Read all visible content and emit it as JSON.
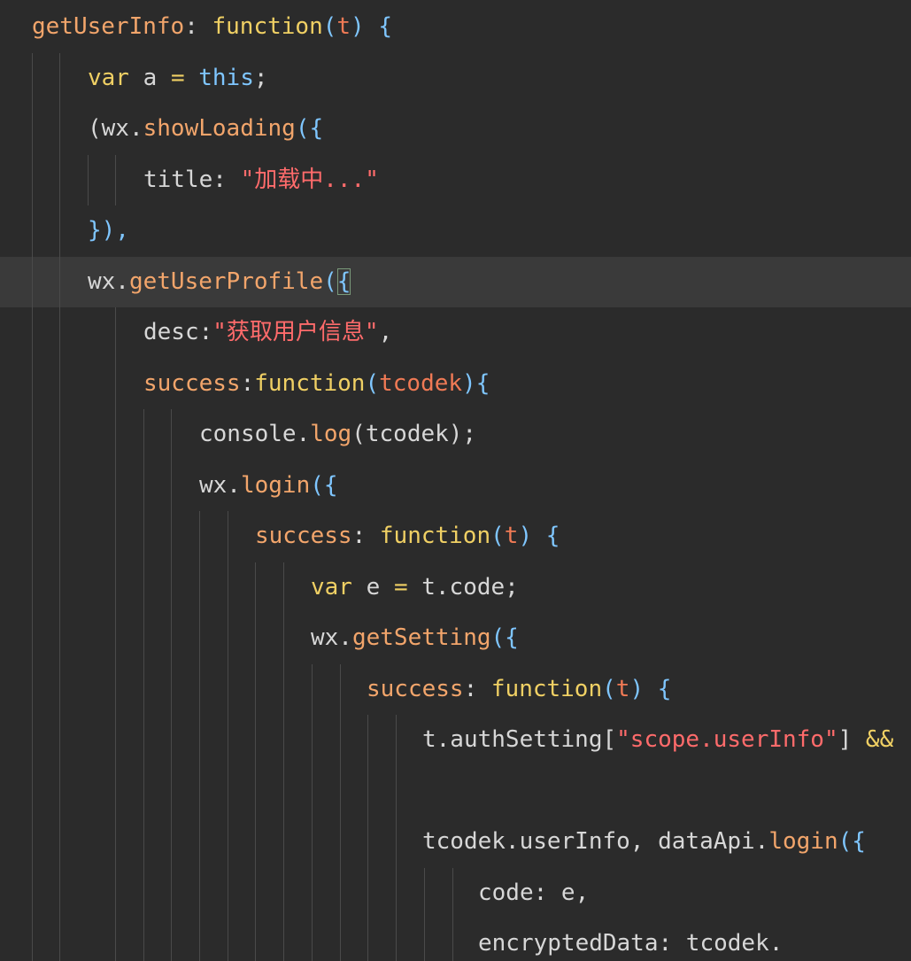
{
  "editor": {
    "lines": [
      {
        "indent": 0,
        "tokens": [
          {
            "t": "getUserInfo",
            "c": "key"
          },
          {
            "t": ": ",
            "c": "plain"
          },
          {
            "t": "function",
            "c": "fn"
          },
          {
            "t": "(",
            "c": "brace"
          },
          {
            "t": "t",
            "c": "param"
          },
          {
            "t": ") ",
            "c": "brace"
          },
          {
            "t": "{",
            "c": "brace"
          }
        ]
      },
      {
        "indent": 1,
        "tokens": [
          {
            "t": "var",
            "c": "kw"
          },
          {
            "t": " a ",
            "c": "plain"
          },
          {
            "t": "=",
            "c": "op"
          },
          {
            "t": " ",
            "c": "plain"
          },
          {
            "t": "this",
            "c": "this"
          },
          {
            "t": ";",
            "c": "plain"
          }
        ]
      },
      {
        "indent": 1,
        "tokens": [
          {
            "t": "(wx.",
            "c": "plain"
          },
          {
            "t": "showLoading",
            "c": "method"
          },
          {
            "t": "({",
            "c": "brace"
          }
        ]
      },
      {
        "indent": 2,
        "tokens": [
          {
            "t": "title: ",
            "c": "plain"
          },
          {
            "t": "\"加载中...\"",
            "c": "str"
          }
        ]
      },
      {
        "indent": 1,
        "tokens": [
          {
            "t": "}),",
            "c": "brace"
          }
        ]
      },
      {
        "indent": 1,
        "highlight": true,
        "tokens": [
          {
            "t": "wx.",
            "c": "plain"
          },
          {
            "t": "getUserProfile",
            "c": "method"
          },
          {
            "t": "(",
            "c": "brace"
          },
          {
            "t": "{",
            "c": "brace",
            "match": true
          }
        ]
      },
      {
        "indent": 2,
        "tokens": [
          {
            "t": "desc:",
            "c": "plain"
          },
          {
            "t": "\"获取用户信息\"",
            "c": "str"
          },
          {
            "t": ",",
            "c": "plain"
          }
        ]
      },
      {
        "indent": 2,
        "tokens": [
          {
            "t": "success",
            "c": "key"
          },
          {
            "t": ":",
            "c": "plain"
          },
          {
            "t": "function",
            "c": "fn"
          },
          {
            "t": "(",
            "c": "brace"
          },
          {
            "t": "tcodek",
            "c": "param"
          },
          {
            "t": "){",
            "c": "brace"
          }
        ]
      },
      {
        "indent": 3,
        "tokens": [
          {
            "t": "console.",
            "c": "plain"
          },
          {
            "t": "log",
            "c": "method"
          },
          {
            "t": "(tcodek);",
            "c": "plain"
          }
        ]
      },
      {
        "indent": 3,
        "tokens": [
          {
            "t": "wx.",
            "c": "plain"
          },
          {
            "t": "login",
            "c": "method"
          },
          {
            "t": "({",
            "c": "brace"
          }
        ]
      },
      {
        "indent": 4,
        "tokens": [
          {
            "t": "success",
            "c": "key"
          },
          {
            "t": ": ",
            "c": "plain"
          },
          {
            "t": "function",
            "c": "fn"
          },
          {
            "t": "(",
            "c": "brace"
          },
          {
            "t": "t",
            "c": "param"
          },
          {
            "t": ") ",
            "c": "brace"
          },
          {
            "t": "{",
            "c": "brace"
          }
        ]
      },
      {
        "indent": 5,
        "tokens": [
          {
            "t": "var",
            "c": "kw"
          },
          {
            "t": " e ",
            "c": "plain"
          },
          {
            "t": "=",
            "c": "op"
          },
          {
            "t": " t.code;",
            "c": "plain"
          }
        ]
      },
      {
        "indent": 5,
        "tokens": [
          {
            "t": "wx.",
            "c": "plain"
          },
          {
            "t": "getSetting",
            "c": "method"
          },
          {
            "t": "({",
            "c": "brace"
          }
        ]
      },
      {
        "indent": 6,
        "tokens": [
          {
            "t": "success",
            "c": "key"
          },
          {
            "t": ": ",
            "c": "plain"
          },
          {
            "t": "function",
            "c": "fn"
          },
          {
            "t": "(",
            "c": "brace"
          },
          {
            "t": "t",
            "c": "param"
          },
          {
            "t": ") ",
            "c": "brace"
          },
          {
            "t": "{",
            "c": "brace"
          }
        ]
      },
      {
        "indent": 7,
        "tokens": [
          {
            "t": "t.authSetting[",
            "c": "plain"
          },
          {
            "t": "\"scope.userInfo\"",
            "c": "str"
          },
          {
            "t": "] ",
            "c": "plain"
          },
          {
            "t": "&&",
            "c": "op"
          }
        ]
      },
      {
        "indent": 7,
        "tokens": []
      },
      {
        "indent": 7,
        "tokens": [
          {
            "t": "tcodek.userInfo, dataApi.",
            "c": "plain"
          },
          {
            "t": "login",
            "c": "method"
          },
          {
            "t": "({",
            "c": "brace"
          }
        ]
      },
      {
        "indent": 8,
        "tokens": [
          {
            "t": "code: e,",
            "c": "plain"
          }
        ]
      },
      {
        "indent": 8,
        "tokens": [
          {
            "t": "encryptedData: tcodek.",
            "c": "plain"
          }
        ]
      }
    ]
  }
}
